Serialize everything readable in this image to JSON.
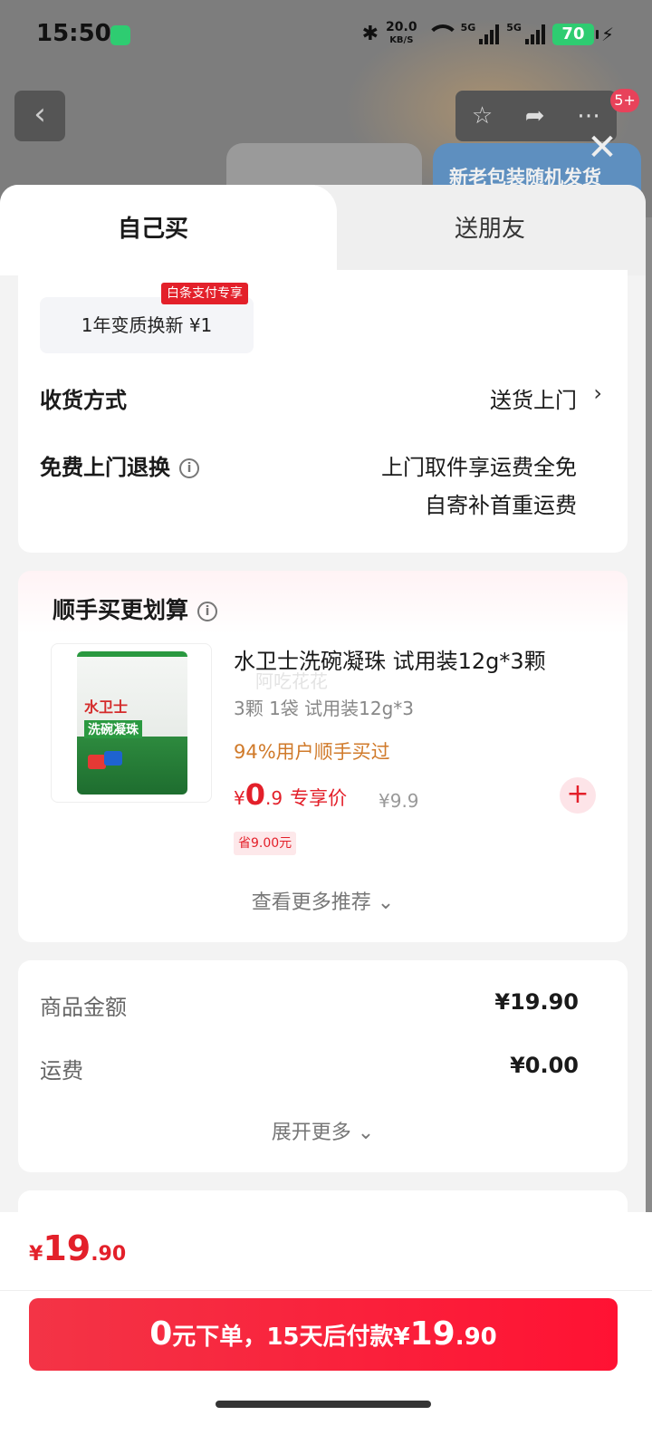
{
  "status_bar": {
    "time": "15:50",
    "net_speed_value": "20.0",
    "net_speed_unit": "KB/S",
    "sim1_label": "5G",
    "sim2_label": "5G",
    "battery": "70"
  },
  "header": {
    "badge": "5+",
    "banner_text": "新老包装随机发货"
  },
  "tabs": {
    "self": "自己买",
    "friend": "送朋友"
  },
  "service": {
    "chip_label": "1年变质换新 ¥1",
    "chip_tag": "白条支付专享"
  },
  "delivery": {
    "label": "收货方式",
    "value": "送货上门"
  },
  "returns": {
    "label": "免费上门退换",
    "line1": "上门取件享运费全免",
    "line2": "自寄补首重运费"
  },
  "addon": {
    "title": "顺手买更划算",
    "product": {
      "brand_on_pack": "水卫士",
      "name_on_pack": "洗碗凝珠",
      "title": "水卫士洗碗凝珠 试用装12g*3颗",
      "watermark": "阿吃花花",
      "spec": "3颗 1袋 试用装12g*3",
      "popularity": "94%用户顺手买过",
      "price_symbol": "¥",
      "price_int": "0",
      "price_dec": ".9",
      "price_label": "专享价",
      "original_price": "¥9.9",
      "save": "省9.00元"
    },
    "see_more": "查看更多推荐"
  },
  "summary": {
    "goods_label": "商品金额",
    "goods_value": "¥19.90",
    "shipping_label": "运费",
    "shipping_value": "¥0.00",
    "expand": "展开更多"
  },
  "footer": {
    "total_symbol": "¥",
    "total_int": "19",
    "total_dec": ".90",
    "pay_num1": "0",
    "pay_txt1": "元下单，",
    "pay_num2": "15",
    "pay_txt2": "天后付款¥",
    "pay_num3": "19",
    "pay_txt3": ".90"
  },
  "colors": {
    "accent_red": "#e3202a",
    "button_red": "#f33446",
    "popularity_orange": "#d07a2a"
  },
  "icons": [
    "back-arrow-icon",
    "star-icon",
    "share-icon",
    "more-icon",
    "close-icon",
    "info-icon",
    "chevron-right-icon",
    "plus-icon",
    "chevron-down-icon"
  ]
}
